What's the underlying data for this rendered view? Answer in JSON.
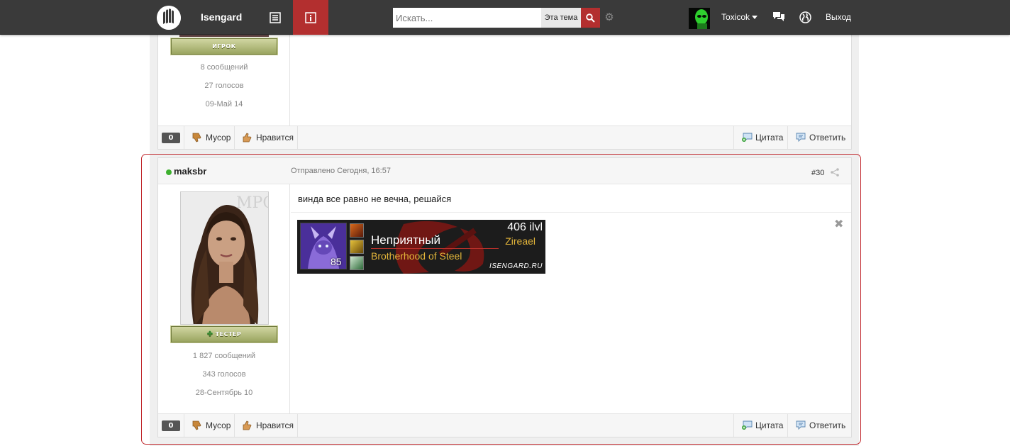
{
  "header": {
    "site_title": "Isengard",
    "search_placeholder": "Искать...",
    "search_scope": "Эта тема",
    "user_name": "Toxicok",
    "logout_label": "Выход"
  },
  "colors": {
    "accent": "#b32f2f",
    "topbar": "#3a3a3a",
    "highlight_border": "#c0282d",
    "online": "#3db02f",
    "guild_gold": "#e3b53a"
  },
  "posts": [
    {
      "rank": "ИГРОК",
      "stats": [
        "8 сообщений",
        "27 голосов",
        "09-Май 14"
      ],
      "rep": "0",
      "actions": {
        "trash": "Мусор",
        "like": "Нравится",
        "quote": "Цитата",
        "reply": "Ответить"
      }
    },
    {
      "author": "maksbr",
      "posted": "Отправлено Сегодня, 16:57",
      "number": "#30",
      "text": "винда все равно не вечна, решайся",
      "rank": "ТЕСТЕР",
      "stats": [
        "1 827 сообщений",
        "343 голосов",
        "28-Сентябрь 10"
      ],
      "rep": "0",
      "actions": {
        "trash": "Мусор",
        "like": "Нравится",
        "quote": "Цитата",
        "reply": "Ответить"
      },
      "signature": {
        "level": "85",
        "character": "Неприятный",
        "guild": "Brotherhood of Steel",
        "ilvl": "406 ilvl",
        "realm": "Zireael",
        "site": "ISENGARD.RU"
      }
    }
  ],
  "icons": [
    "logo-icon",
    "list-icon",
    "info-icon",
    "search-icon",
    "gear-icon",
    "messages-icon",
    "globe-icon",
    "thumb-down-icon",
    "thumb-up-icon",
    "quote-icon",
    "reply-icon",
    "share-icon",
    "close-icon"
  ]
}
